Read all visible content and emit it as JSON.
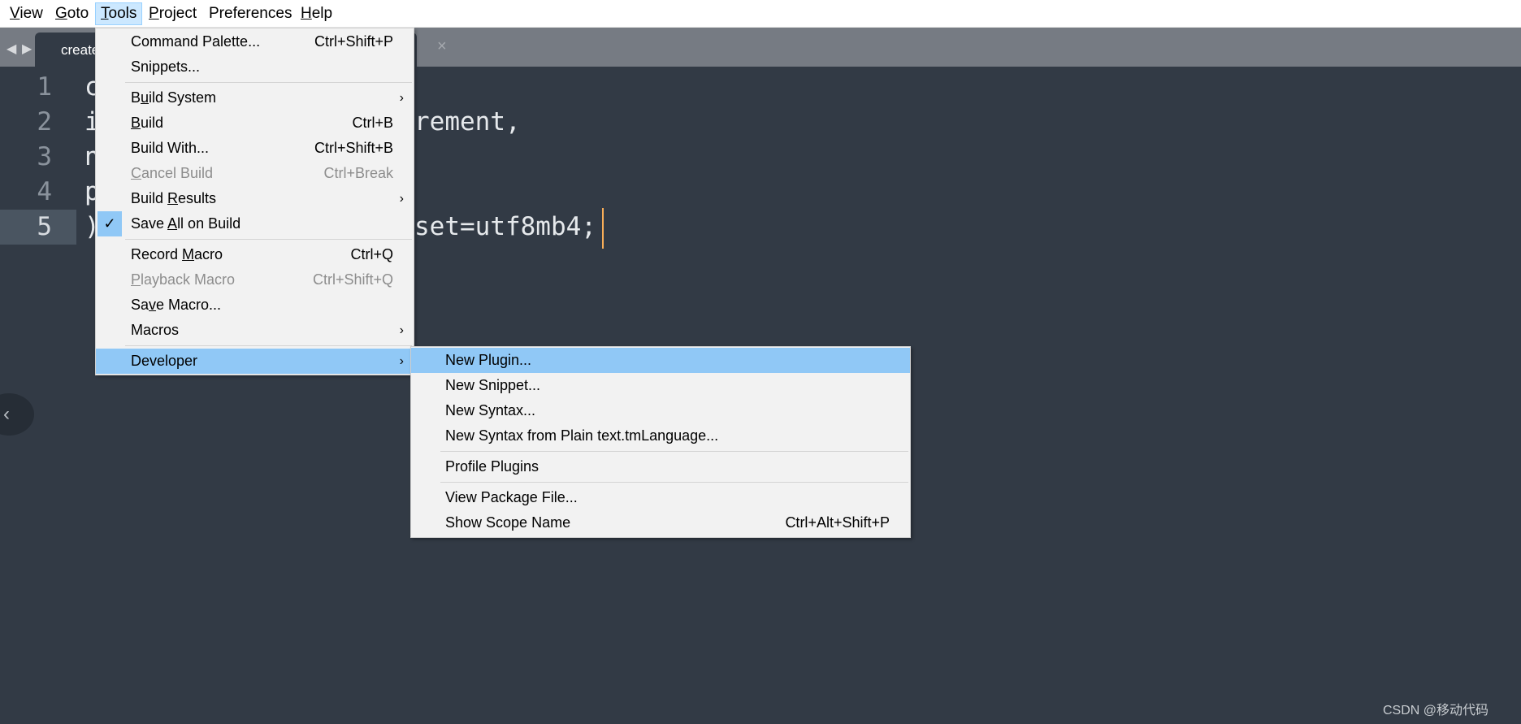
{
  "menubar": [
    {
      "label": "View",
      "mn": 0
    },
    {
      "label": "Goto",
      "mn": 0
    },
    {
      "label": "Tools",
      "mn": 0,
      "open": true
    },
    {
      "label": "Project",
      "mn": 0
    },
    {
      "label": "Preferences",
      "mn": 8
    },
    {
      "label": "Help",
      "mn": 0
    }
  ],
  "tabbar": {
    "back": "◀",
    "forward": "▶",
    "tab_label": "create",
    "close": "×"
  },
  "editor": {
    "lines": [
      {
        "num": "1",
        "start": "c",
        "tail": ""
      },
      {
        "num": "2",
        "start": "i",
        "tail": "rement,"
      },
      {
        "num": "3",
        "start": "n",
        "tail": ""
      },
      {
        "num": "4",
        "start": "p",
        "tail": ""
      },
      {
        "num": "5",
        "start": ")",
        "tail": "set=utf8mb4;",
        "current": true
      }
    ]
  },
  "tools_menu": {
    "items": [
      {
        "label": "Command Palette...",
        "shortcut": "Ctrl+Shift+P"
      },
      {
        "label": "Snippets..."
      },
      {
        "sep": true
      },
      {
        "label": "Build System",
        "mn": 1,
        "submenu": true
      },
      {
        "label": "Build",
        "mn": 0,
        "shortcut": "Ctrl+B"
      },
      {
        "label": "Build With...",
        "shortcut": "Ctrl+Shift+B"
      },
      {
        "label": "Cancel Build",
        "mn": 0,
        "shortcut": "Ctrl+Break",
        "disabled": true
      },
      {
        "label": "Build Results",
        "mn": 6,
        "submenu": true
      },
      {
        "label": "Save All on Build",
        "mn": 5,
        "checked": true
      },
      {
        "sep": true
      },
      {
        "label": "Record Macro",
        "mn": 7,
        "shortcut": "Ctrl+Q"
      },
      {
        "label": "Playback Macro",
        "mn": 0,
        "shortcut": "Ctrl+Shift+Q",
        "disabled": true
      },
      {
        "label": "Save Macro...",
        "mn": 2
      },
      {
        "label": "Macros",
        "submenu": true
      },
      {
        "sep": true
      },
      {
        "label": "Developer",
        "submenu": true,
        "highlighted": true
      }
    ]
  },
  "developer_menu": {
    "items": [
      {
        "label": "New Plugin...",
        "highlighted": true
      },
      {
        "label": "New Snippet..."
      },
      {
        "label": "New Syntax..."
      },
      {
        "label": "New Syntax from Plain text.tmLanguage..."
      },
      {
        "sep": true
      },
      {
        "label": "Profile Plugins"
      },
      {
        "sep": true
      },
      {
        "label": "View Package File..."
      },
      {
        "label": "Show Scope Name",
        "shortcut": "Ctrl+Alt+Shift+P"
      }
    ]
  },
  "side_button": {
    "icon": "chevron-left-icon",
    "glyph": "‹"
  },
  "watermark": "CSDN @移动代码",
  "colors": {
    "editor_bg": "#323a45",
    "highlight": "#90c8f6",
    "caret": "#f9ae58"
  }
}
